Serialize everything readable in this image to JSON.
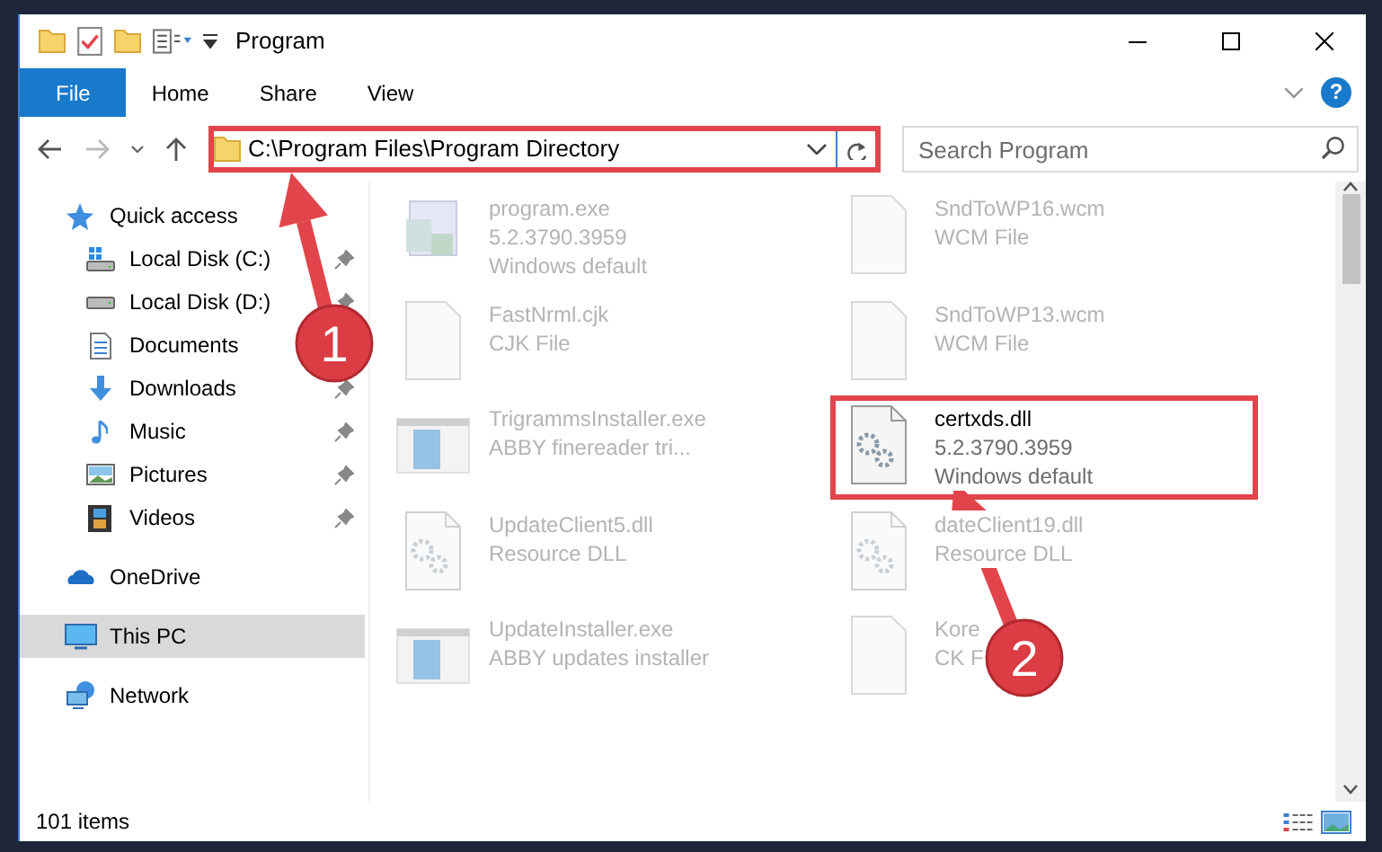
{
  "window": {
    "title": "Program"
  },
  "ribbon": {
    "tabs": [
      {
        "label": "File",
        "selected": true
      },
      {
        "label": "Home",
        "selected": false
      },
      {
        "label": "Share",
        "selected": false
      },
      {
        "label": "View",
        "selected": false
      }
    ],
    "help": "?"
  },
  "address_bar": {
    "path": "C:\\Program Files\\Program Directory",
    "highlighted": true
  },
  "search": {
    "placeholder": "Search Program"
  },
  "sidebar": {
    "items": [
      {
        "label": "Quick access",
        "kind": "star",
        "selected": false,
        "children": [
          {
            "label": "Local Disk (C:)",
            "kind": "systemdrive",
            "pinned": true,
            "selected": false
          },
          {
            "label": "Local Disk (D:)",
            "kind": "drive",
            "pinned": true,
            "selected": false
          },
          {
            "label": "Documents",
            "kind": "document",
            "selected": false
          },
          {
            "label": "Downloads",
            "kind": "download",
            "pinned": true,
            "selected": false
          },
          {
            "label": "Music",
            "kind": "music",
            "pinned": true,
            "selected": false
          },
          {
            "label": "Pictures",
            "kind": "pictures",
            "pinned": true,
            "selected": false
          },
          {
            "label": "Videos",
            "kind": "videos",
            "pinned": true,
            "selected": false
          }
        ]
      },
      {
        "label": "OneDrive",
        "kind": "cloud",
        "selected": false
      },
      {
        "label": "This PC",
        "kind": "computer",
        "selected": true
      },
      {
        "label": "Network",
        "kind": "network",
        "selected": false
      }
    ]
  },
  "files": [
    {
      "name": "program.exe",
      "lines": [
        "5.2.3790.3959",
        "Windows default"
      ],
      "kind": "app",
      "blurred": true,
      "highlighted": false
    },
    {
      "name": "SndToWP16.wcm",
      "lines": [
        "WCM File"
      ],
      "kind": "blank",
      "blurred": true,
      "highlighted": false
    },
    {
      "name": "FastNrml.cjk",
      "lines": [
        "CJK File"
      ],
      "kind": "blank",
      "blurred": true,
      "highlighted": false
    },
    {
      "name": "SndToWP13.wcm",
      "lines": [
        "WCM File"
      ],
      "kind": "blank",
      "blurred": true,
      "highlighted": false
    },
    {
      "name": "TrigrammsInstaller.exe",
      "lines": [
        "ABBY finereader tri..."
      ],
      "kind": "installer",
      "blurred": true,
      "highlighted": false
    },
    {
      "name": "certxds.dll",
      "lines": [
        "5.2.3790.3959",
        "Windows default"
      ],
      "kind": "dll",
      "blurred": false,
      "highlighted": true
    },
    {
      "name": "UpdateClient5.dll",
      "lines": [
        "Resource DLL"
      ],
      "kind": "dll",
      "blurred": true,
      "highlighted": false
    },
    {
      "name": "dateClient19.dll",
      "lines": [
        "Resource DLL"
      ],
      "kind": "dll",
      "blurred": true,
      "highlighted": false
    },
    {
      "name": "UpdateInstaller.exe",
      "lines": [
        "ABBY updates installer"
      ],
      "kind": "installer",
      "blurred": true,
      "highlighted": false
    },
    {
      "name": "Kore",
      "lines": [
        "CK F"
      ],
      "kind": "blank",
      "blurred": true,
      "highlighted": false
    }
  ],
  "status_bar": {
    "count": "101 items"
  },
  "annotations": [
    {
      "number": "1"
    },
    {
      "number": "2"
    }
  ]
}
